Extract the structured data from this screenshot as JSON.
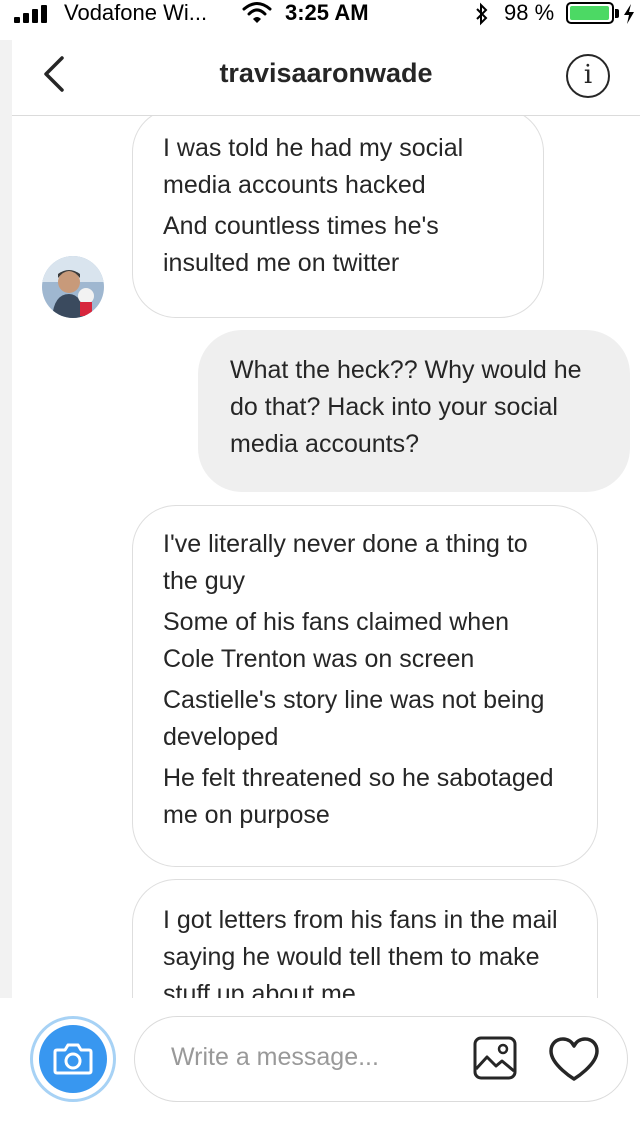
{
  "status_bar": {
    "carrier": "Vodafone Wi...",
    "time": "3:25 AM",
    "battery_percent": "98 %",
    "battery_level": 0.98,
    "icons": [
      "signal-icon",
      "wifi-icon",
      "bluetooth-icon",
      "battery-icon",
      "charging-icon"
    ]
  },
  "header": {
    "title": "travisaaronwade",
    "icons": [
      "back-chevron-icon",
      "info-icon"
    ],
    "info_glyph": "i"
  },
  "messages": [
    {
      "direction": "received",
      "lines": [
        "I was told he had my social media accounts hacked",
        "And countless times he's insulted me on twitter"
      ]
    },
    {
      "direction": "sent",
      "lines": [
        "What the heck?? Why would he do that? Hack into your social media accounts?"
      ]
    },
    {
      "direction": "received",
      "lines": [
        "I've literally never done a thing to the guy",
        "Some of his fans claimed when Cole Trenton was on screen",
        "Castielle's story line was not being developed",
        "He felt threatened so he sabotaged me on purpose"
      ]
    },
    {
      "direction": "received",
      "lines": [
        "I got letters from his fans in the mail saying he would tell them to make stuff up about me"
      ]
    }
  ],
  "composer": {
    "placeholder": "Write a message...",
    "icons": [
      "camera-icon",
      "gallery-icon",
      "heart-icon"
    ]
  },
  "colors": {
    "accent": "#3897f0",
    "sent_bubble": "#efefef",
    "border": "#dbdbdb",
    "battery": "#4cd964"
  }
}
